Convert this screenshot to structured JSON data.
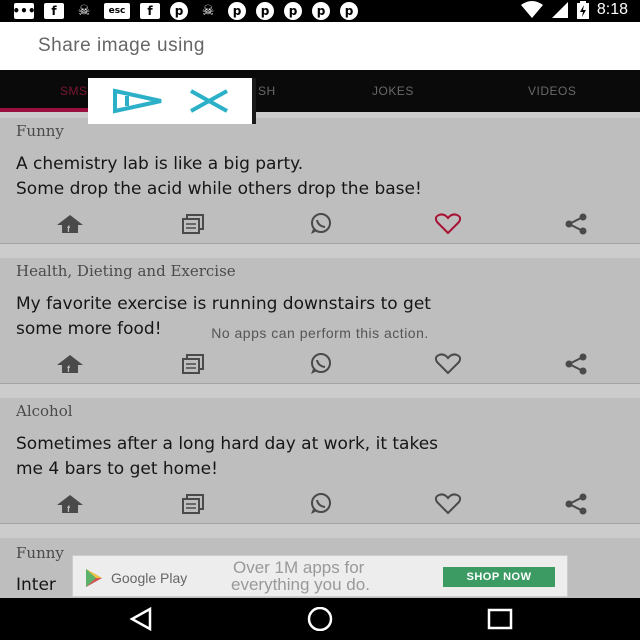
{
  "status_bar": {
    "time": "8:18",
    "left_icons": [
      "chat-bubble-icon",
      "facebook-icon",
      "pirate-icon",
      "esc-icon",
      "facebook-icon",
      "pinterest-icon",
      "pirate-icon",
      "pinterest-icon",
      "pinterest-icon",
      "pinterest-icon",
      "pinterest-icon",
      "pinterest-icon"
    ],
    "right_icons": [
      "wifi-icon",
      "signal-icon",
      "battery-charging-icon"
    ]
  },
  "share_dialog": {
    "title": "Share image using",
    "empty_message": "No apps can perform this action."
  },
  "tabs": [
    {
      "label": "SMS",
      "active": true
    },
    {
      "label": "SH",
      "active": false
    },
    {
      "label": "JOKES",
      "active": false
    },
    {
      "label": "VIDEOS",
      "active": false
    }
  ],
  "cards": [
    {
      "category": "Funny",
      "text": "A chemistry lab is like a big party.\nSome drop the acid while others drop the base!",
      "liked": true
    },
    {
      "category": "Health, Dieting and Exercise",
      "text": "My favorite exercise is running downstairs to get\nsome more food!",
      "liked": false
    },
    {
      "category": "Alcohol",
      "text": "Sometimes after a long hard day at work, it takes\nme 4 bars to get home!",
      "liked": false
    }
  ],
  "peek_card": {
    "category": "Funny",
    "text": "Inter"
  },
  "ad": {
    "brand": "Google Play",
    "line1": "Over 1M apps for",
    "line2": "everything you do.",
    "button": "SHOP NOW"
  },
  "colors": {
    "accent": "#b01448",
    "like": "#c0143c",
    "ad_button": "#3c9a63"
  }
}
